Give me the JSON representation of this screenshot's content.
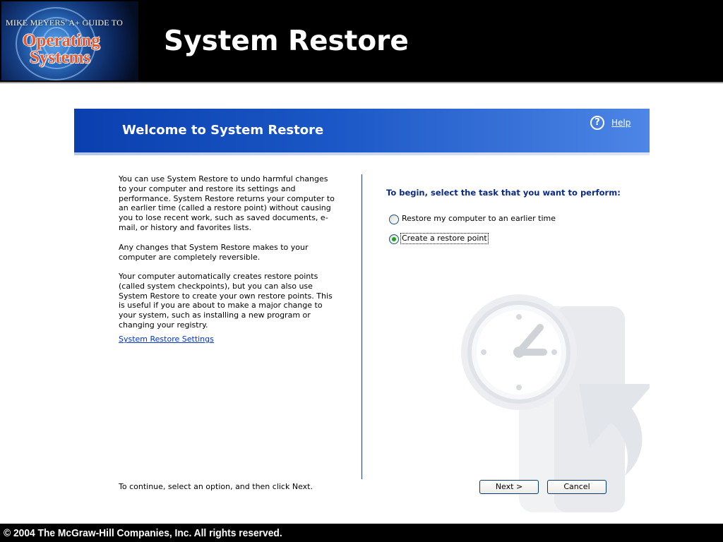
{
  "slide": {
    "title": "System Restore",
    "logo": {
      "line1": "MIKE MEYERS' A+ GUIDE TO",
      "line2": "Operating",
      "line3": "Systems"
    },
    "copyright": "© 2004 The McGraw-Hill Companies, Inc. All rights reserved."
  },
  "dialog": {
    "title": "Welcome to System Restore",
    "help_label": "Help",
    "help_icon": "question-circle-icon",
    "paragraphs": [
      "You can use System Restore to undo harmful changes to your computer and restore its settings and performance. System Restore returns your computer to an earlier time (called a restore point) without causing you to lose recent work, such as saved documents, e-mail, or history and favorites lists.",
      "Any changes that System Restore makes to your computer are completely reversible.",
      "Your computer automatically creates restore points (called system checkpoints), but you can also use System Restore to create your own restore points. This is useful if you are about to make a major change to your system, such as installing a new program or changing your registry."
    ],
    "settings_link": "System Restore Settings",
    "task_prompt": "To begin, select the task that you want to perform:",
    "options": [
      {
        "label": "Restore my computer to an earlier time",
        "selected": false
      },
      {
        "label": "Create a restore point",
        "selected": true
      }
    ],
    "footer_instruction": "To continue, select an option, and then click Next.",
    "next_label": "Next >",
    "cancel_label": "Cancel",
    "watermark_icon": "clock-restore-icon"
  },
  "colors": {
    "banner_start": "#0a3fae",
    "banner_end": "#4d86e6",
    "link": "#0033cc",
    "prompt": "#0a2a86",
    "radio_selected": "#21a121"
  }
}
